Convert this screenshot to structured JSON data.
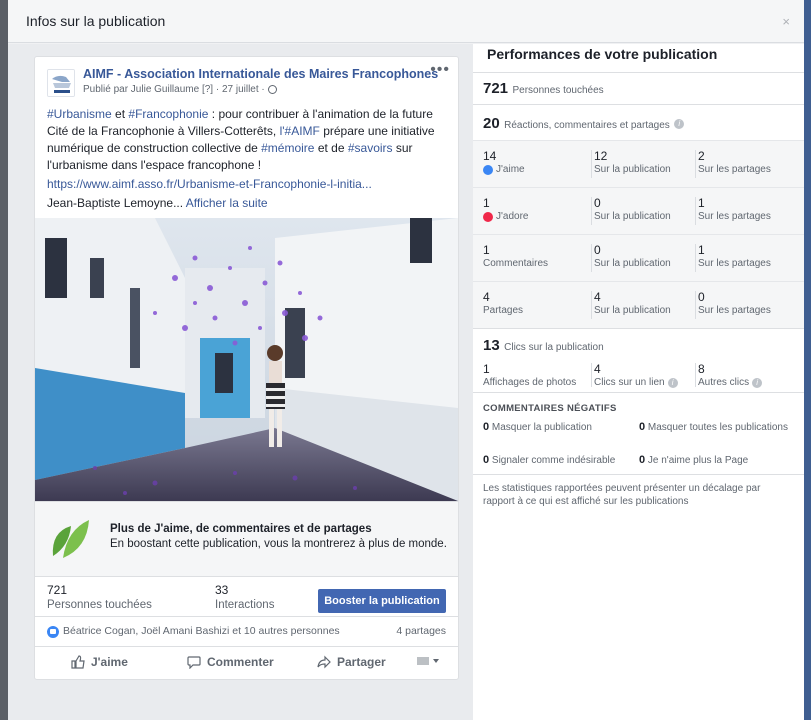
{
  "dialog": {
    "title": "Infos sur la publication",
    "close": "×"
  },
  "post": {
    "author": "AIMF - Association Internationale des Maires Francophones",
    "byline": "Publié par Julie Guillaume [?] · 27 juillet · ",
    "more": "•••",
    "text": {
      "ht1": "#Urbanisme",
      "t1": " et ",
      "ht2": "#Francophonie",
      "t2": " : pour contribuer à l'animation de la future Cité de la Francophonie à Villers-Cotterêts, ",
      "ht3": "l'#AIMF",
      "t3": " prépare une initiative numérique de construction collective de ",
      "ht4": "#mémoire",
      "t4": " et de ",
      "ht5": "#savoirs",
      "t5": " sur l'urbanisme dans l'espace francophone !"
    },
    "link": "https://www.aimf.asso.fr/Urbanisme-et-Francophonie-l-initia...",
    "signature": "Jean-Baptiste Lemoyne...",
    "see_more": "Afficher la suite"
  },
  "promo": {
    "title": "Plus de J'aime, de commentaires et de partages",
    "subtitle": "En boostant cette publication, vous la montrerez à plus de monde."
  },
  "stats": {
    "reach_num": "721",
    "reach_label": "Personnes touchées",
    "interactions_num": "33",
    "interactions_label": "Interactions",
    "boost_label": "Booster la publication"
  },
  "reactions": {
    "names": "Béatrice Cogan, Joël Amani Bashizi et 10 autres personnes",
    "shares": "4 partages"
  },
  "actions": {
    "like": "J'aime",
    "comment": "Commenter",
    "share": "Partager"
  },
  "performance": {
    "title": "Performances de votre publication",
    "reach_num": "721",
    "reach_label": "Personnes touchées",
    "engagement_num": "20",
    "engagement_label": "Réactions, commentaires et partages",
    "rows": [
      {
        "num": "14",
        "label": "J'aime",
        "post_num": "12",
        "post_label": "Sur la publication",
        "share_num": "2",
        "share_label": "Sur les partages"
      },
      {
        "num": "1",
        "label": "J'adore",
        "post_num": "0",
        "post_label": "Sur la publication",
        "share_num": "1",
        "share_label": "Sur les partages"
      },
      {
        "num": "1",
        "label": "Commentaires",
        "post_num": "0",
        "post_label": "Sur la publication",
        "share_num": "1",
        "share_label": "Sur les partages"
      },
      {
        "num": "4",
        "label": "Partages",
        "post_num": "4",
        "post_label": "Sur la publication",
        "share_num": "0",
        "share_label": "Sur les partages"
      }
    ],
    "clicks_num": "13",
    "clicks_label": "Clics sur la publication",
    "clicks": [
      {
        "num": "1",
        "label": "Affichages de photos"
      },
      {
        "num": "4",
        "label": "Clics sur un lien"
      },
      {
        "num": "8",
        "label": "Autres clics"
      }
    ],
    "negative_title": "COMMENTAIRES NÉGATIFS",
    "negative": [
      {
        "num": "0",
        "label": "Masquer la publication"
      },
      {
        "num": "0",
        "label": "Masquer toutes les publications"
      },
      {
        "num": "0",
        "label": "Signaler comme indésirable"
      },
      {
        "num": "0",
        "label": "Je n'aime plus la Page"
      }
    ],
    "disclaimer": "Les statistiques rapportées peuvent présenter un décalage par rapport à ce qui est affiché sur les publications"
  },
  "colors": {
    "link": "#385898",
    "button": "#4267b2",
    "like_blue": "#3a86f4",
    "love_red": "#f0284a"
  }
}
